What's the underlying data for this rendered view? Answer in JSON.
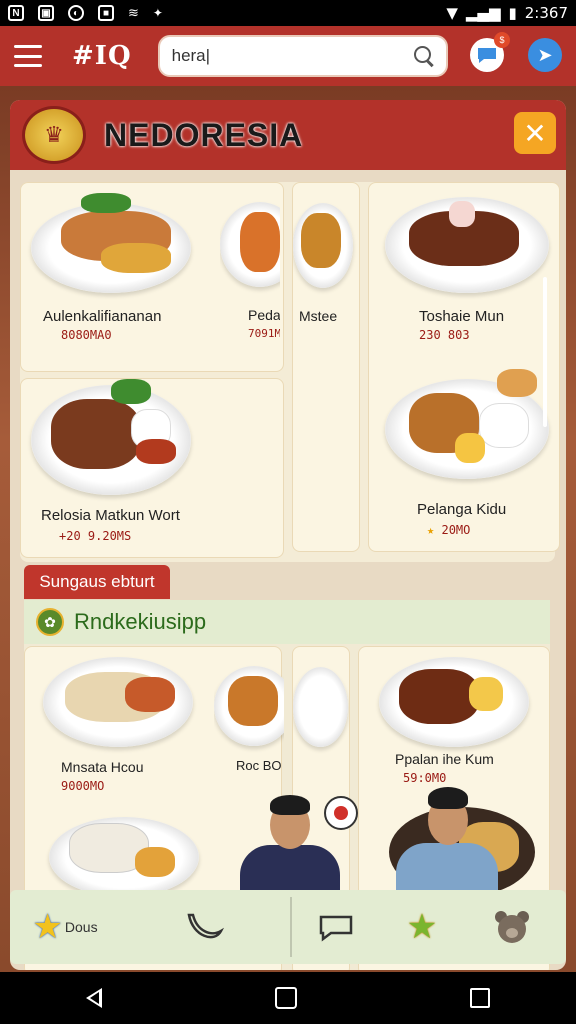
{
  "status_bar": {
    "time": "2:367"
  },
  "app_bar": {
    "brand": "#IQ",
    "search_value": "hera|",
    "chat_badge": "$"
  },
  "card": {
    "title": "NEDORESIA",
    "close_glyph": "✕",
    "dishes": [
      {
        "name": "Aulenkalifiananan",
        "price": "8080MA0"
      },
      {
        "name": "Pedai",
        "price": "7091M"
      },
      {
        "name": "Mstee",
        "price": ""
      },
      {
        "name": "Toshaie Mun",
        "price": "230 803"
      },
      {
        "name": "Relosia Matkun Wort",
        "price": "+20 9.20MS"
      },
      {
        "name": "Pelanga Kidu",
        "price": "20MO"
      }
    ],
    "section_tab": "Sungaus ebturt",
    "section_title": "Rndkekiusipp",
    "section_dishes": [
      {
        "name": "Mnsata Hcou",
        "price": "9000MO"
      },
      {
        "name": "Roc BO",
        "price": ""
      },
      {
        "name": "Ppalan ihe Kum",
        "price": "59:0M0"
      }
    ]
  },
  "bottom_bar": {
    "left_label": "Dous",
    "icons": [
      "star-icon",
      "banana-icon",
      "chat-bubble-icon",
      "star-icon",
      "bear-icon"
    ]
  },
  "colors": {
    "primary_red": "#b3322a",
    "accent_orange": "#f5a623",
    "card_bg": "#e8dac4",
    "section_green": "#2c6b1c"
  }
}
